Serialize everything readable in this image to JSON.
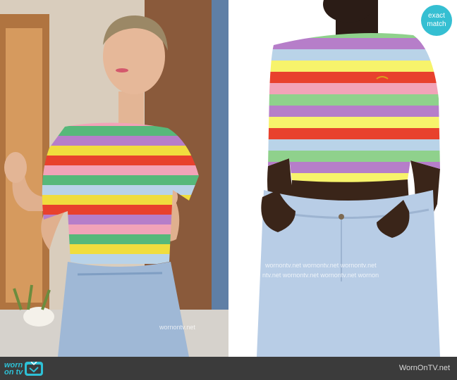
{
  "badge": {
    "line1": "exact",
    "line2": "match"
  },
  "watermark": {
    "row1": "wornontv.net  wornontv.net  wornontv.net",
    "row2": "ntv.net  wornontv.net  wornontv.net  wornon",
    "left": "wornontv.net"
  },
  "footer": {
    "logo_top": "worn",
    "logo_bottom": "on tv",
    "site": "WornOnTV.net"
  },
  "colors": {
    "brand": "#2ec1d6",
    "stripes": [
      "#f2a3b8",
      "#57b87a",
      "#b67ec9",
      "#f0dd3e",
      "#e8412d",
      "#b9d3e8",
      "#f7f36b",
      "#8fd18c"
    ]
  }
}
